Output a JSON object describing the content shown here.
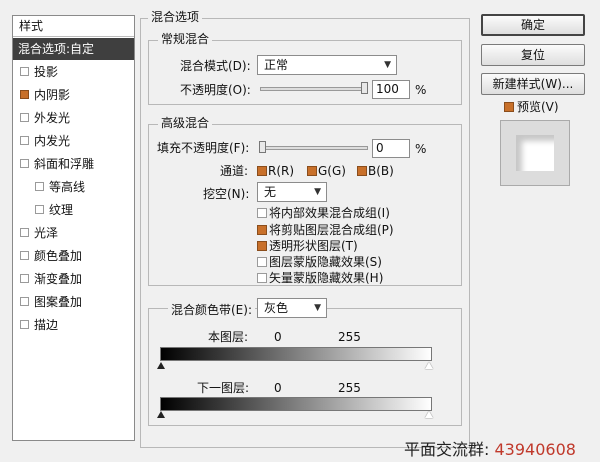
{
  "style_list": {
    "header": "样式",
    "items": [
      {
        "label": "混合选项:自定",
        "selected": true
      },
      {
        "label": "投影",
        "checked": false
      },
      {
        "label": "内阴影",
        "checked": true
      },
      {
        "label": "外发光",
        "checked": false
      },
      {
        "label": "内发光",
        "checked": false
      },
      {
        "label": "斜面和浮雕",
        "checked": false
      },
      {
        "label": "等高线",
        "checked": false
      },
      {
        "label": "纹理",
        "checked": false
      },
      {
        "label": "光泽",
        "checked": false
      },
      {
        "label": "颜色叠加",
        "checked": false
      },
      {
        "label": "渐变叠加",
        "checked": false
      },
      {
        "label": "图案叠加",
        "checked": false
      },
      {
        "label": "描边",
        "checked": false
      }
    ]
  },
  "blend_options": {
    "title": "混合选项",
    "general": {
      "title": "常规混合",
      "mode_label": "混合模式(D):",
      "mode_value": "正常",
      "opacity_label": "不透明度(O):",
      "opacity_value": "100",
      "percent": "%"
    },
    "advanced": {
      "title": "高级混合",
      "fill_label": "填充不透明度(F):",
      "fill_value": "0",
      "percent": "%",
      "channels_label": "通道:",
      "channel_r": "R(R)",
      "channel_g": "G(G)",
      "channel_b": "B(B)",
      "knockout_label": "挖空(N):",
      "knockout_value": "无",
      "options": [
        {
          "label": "将内部效果混合成组(I)",
          "checked": false
        },
        {
          "label": "将剪贴图层混合成组(P)",
          "checked": true
        },
        {
          "label": "透明形状图层(T)",
          "checked": true
        },
        {
          "label": "图层蒙版隐藏效果(S)",
          "checked": false
        },
        {
          "label": "矢量蒙版隐藏效果(H)",
          "checked": false
        }
      ]
    },
    "blend_if": {
      "label": "混合颜色带(E):",
      "value": "灰色",
      "this_layer": "本图层:",
      "this_min": "0",
      "this_max": "255",
      "underlying": "下一图层:",
      "under_min": "0",
      "under_max": "255"
    }
  },
  "buttons": {
    "ok": "确定",
    "reset": "复位",
    "new_style": "新建样式(W)...",
    "preview": "预览(V)"
  },
  "watermark": {
    "text": "平面交流群:",
    "number": "43940608"
  },
  "colors": {
    "accent_checkbox": "#c8702a",
    "selected_row": "#3f3f3f"
  }
}
